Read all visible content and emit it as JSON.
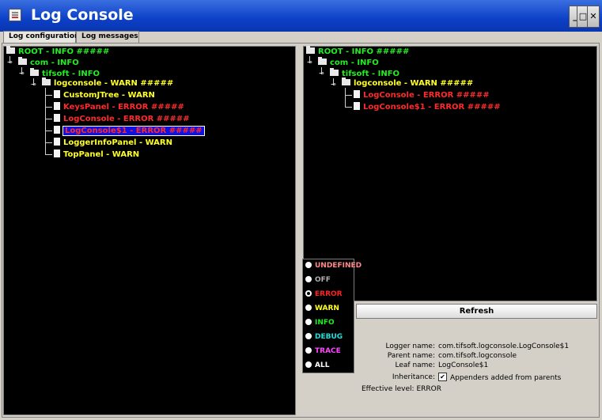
{
  "window": {
    "title": "Log Console",
    "buttons": {
      "minimize": "_",
      "maximize": "□",
      "close": "✕"
    }
  },
  "tabs": [
    {
      "label": "Log configuration",
      "active": true
    },
    {
      "label": "Log messages",
      "active": false
    }
  ],
  "left_tree": [
    {
      "label": "ROOT - INFO #####",
      "level": "INFO",
      "type": "folder"
    },
    {
      "label": "com - INFO",
      "level": "INFO",
      "type": "folder"
    },
    {
      "label": "tifsoft - INFO",
      "level": "INFO",
      "type": "folder"
    },
    {
      "label": "logconsole - WARN #####",
      "level": "WARN",
      "type": "folder"
    },
    {
      "label": "CustomJTree - WARN",
      "level": "WARN",
      "type": "leaf"
    },
    {
      "label": "KeysPanel - ERROR #####",
      "level": "ERROR",
      "type": "leaf"
    },
    {
      "label": "LogConsole - ERROR #####",
      "level": "ERROR",
      "type": "leaf"
    },
    {
      "label": "LogConsole$1 - ERROR #####",
      "level": "ERROR",
      "type": "leaf",
      "selected": true
    },
    {
      "label": "LoggerInfoPanel - WARN",
      "level": "WARN",
      "type": "leaf"
    },
    {
      "label": "TopPanel - WARN",
      "level": "WARN",
      "type": "leaf"
    }
  ],
  "right_tree": [
    {
      "label": "ROOT - INFO #####",
      "level": "INFO",
      "type": "folder"
    },
    {
      "label": "com - INFO",
      "level": "INFO",
      "type": "folder"
    },
    {
      "label": "tifsoft - INFO",
      "level": "INFO",
      "type": "folder"
    },
    {
      "label": "logconsole - WARN #####",
      "level": "WARN",
      "type": "folder"
    },
    {
      "label": "LogConsole - ERROR #####",
      "level": "ERROR",
      "type": "leaf"
    },
    {
      "label": "LogConsole$1 - ERROR #####",
      "level": "ERROR",
      "type": "leaf"
    }
  ],
  "levels": [
    {
      "label": "UNDEFINED",
      "color": "#ff8888"
    },
    {
      "label": "OFF",
      "color": "#b0b0b0"
    },
    {
      "label": "ERROR",
      "color": "#ff2222",
      "selected": true
    },
    {
      "label": "WARN",
      "color": "#ffff22"
    },
    {
      "label": "INFO",
      "color": "#22ee22"
    },
    {
      "label": "DEBUG",
      "color": "#22dddd"
    },
    {
      "label": "TRACE",
      "color": "#ff44ff"
    },
    {
      "label": "ALL",
      "color": "#ffffff"
    }
  ],
  "refresh_label": "Refresh",
  "logger_info": {
    "logger_name_label": "Logger name:",
    "logger_name": "com.tifsoft.logconsole.LogConsole$1",
    "parent_name_label": "Parent name:",
    "parent_name": "com.tifsoft.logconsole",
    "leaf_name_label": "Leaf name:",
    "leaf_name": "LogConsole$1",
    "inheritance_label": "Inheritance:",
    "inheritance_value": "Appenders added from parents",
    "inheritance_checked": true,
    "effective_level_label": "Effective level:",
    "effective_level": "ERROR"
  }
}
